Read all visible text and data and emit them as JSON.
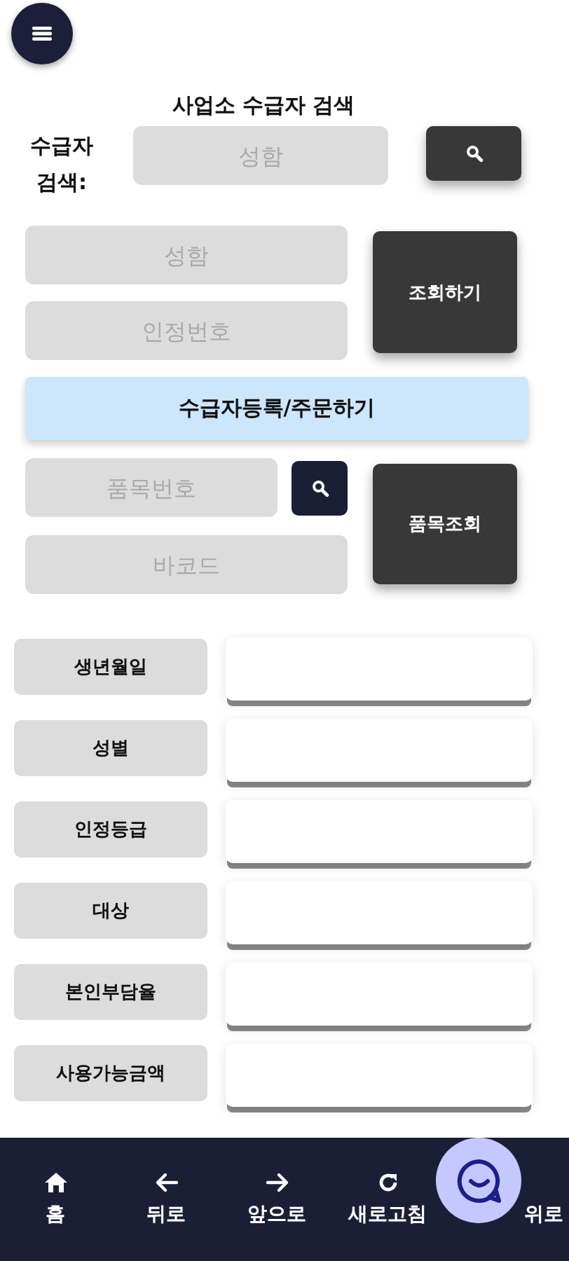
{
  "title": "사업소 수급자 검색",
  "recipient_search": {
    "label": "수급자 검색:",
    "placeholder": "성함"
  },
  "lookup": {
    "fields": [
      {
        "placeholder": "성함"
      },
      {
        "placeholder": "인정번호"
      }
    ],
    "button": "조회하기"
  },
  "register_button": "수급자등록/주문하기",
  "item_lookup": {
    "fields": [
      {
        "placeholder": "품목번호",
        "kind": "search"
      },
      {
        "placeholder": "바코드",
        "kind": "plain"
      }
    ],
    "button": "품목조회"
  },
  "info_rows": [
    {
      "label": "생년월일"
    },
    {
      "label": "성별"
    },
    {
      "label": "인정등급"
    },
    {
      "label": "대상"
    },
    {
      "label": "본인부담율"
    },
    {
      "label": "사용가능금액"
    }
  ],
  "nav": [
    {
      "label": "홈",
      "kind": "home"
    },
    {
      "label": "뒤로",
      "kind": "back"
    },
    {
      "label": "앞으로",
      "kind": "forward"
    },
    {
      "label": "새로고침",
      "kind": "refresh"
    },
    {
      "label": "위로",
      "kind": "top"
    }
  ]
}
